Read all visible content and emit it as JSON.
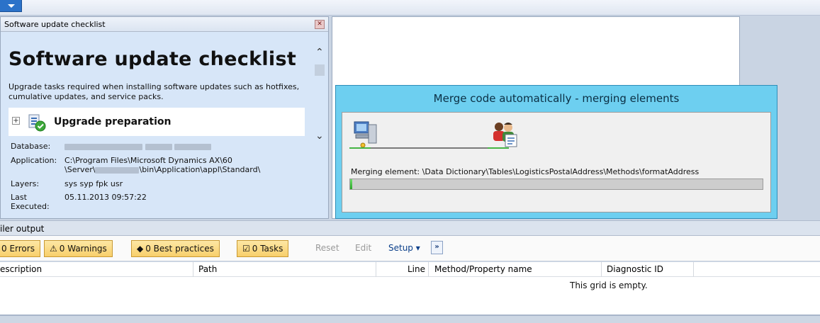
{
  "panel": {
    "title": "Software update checklist",
    "heading": "Software update checklist",
    "description": "Upgrade tasks required when installing software updates such as hotfixes, cumulative updates, and service packs.",
    "section": "Upgrade preparation",
    "info": {
      "database_label": "Database:",
      "application_label": "Application:",
      "application_line1": "C:\\Program Files\\Microsoft Dynamics AX\\60",
      "application_line2_a": "\\Server\\",
      "application_line2_b": "\\bin\\Application\\appl\\Standard\\",
      "layers_label": "Layers:",
      "layers_value": "sys syp fpk usr",
      "last_label_1": "Last",
      "last_label_2": "Executed:",
      "last_value": "05.11.2013 09:57:22"
    }
  },
  "merge": {
    "title": "Merge code automatically - merging elements",
    "message": "Merging element: \\Data Dictionary\\Tables\\LogisticsPostalAddress\\Methods\\formatAddress",
    "progress": 0
  },
  "compiler": {
    "label": "iler output",
    "buttons": {
      "errors": "0 Errors",
      "warnings": "0 Warnings",
      "best_practices": "0 Best practices",
      "tasks": "0 Tasks",
      "reset": "Reset",
      "edit": "Edit",
      "setup": "Setup"
    },
    "columns": [
      "escription",
      "Path",
      "Line",
      "Method/Property name",
      "Diagnostic ID"
    ],
    "empty_text": "This grid is empty."
  },
  "colors": {
    "accent": "#6dcff0",
    "panel_bg": "#d7e6f8",
    "button_bg": "#f8cf6b",
    "progress_green": "#2ca52a"
  }
}
